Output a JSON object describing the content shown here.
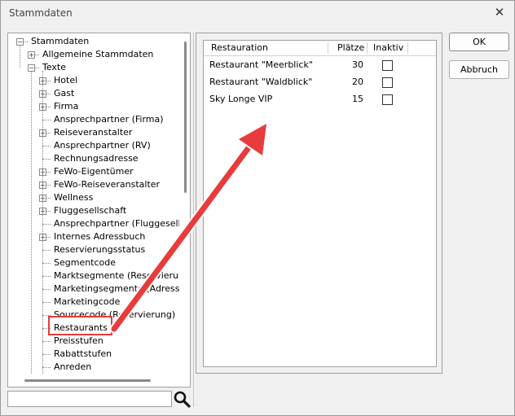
{
  "window": {
    "title": "Stammdaten",
    "close_glyph": "✕"
  },
  "tree": {
    "items": [
      {
        "label": "Stammdaten",
        "expander": "−"
      },
      {
        "label": "Allgemeine Stammdaten",
        "expander": "+"
      },
      {
        "label": "Texte",
        "expander": "−"
      },
      {
        "label": "Hotel",
        "expander": "+"
      },
      {
        "label": "Gast",
        "expander": "+"
      },
      {
        "label": "Firma",
        "expander": "+"
      },
      {
        "label": "Ansprechpartner (Firma)",
        "expander": ""
      },
      {
        "label": "Reiseveranstalter",
        "expander": "+"
      },
      {
        "label": "Ansprechpartner (RV)",
        "expander": ""
      },
      {
        "label": "Rechnungsadresse",
        "expander": ""
      },
      {
        "label": "FeWo-Eigentümer",
        "expander": "+"
      },
      {
        "label": "FeWo-Reiseveranstalter",
        "expander": "+"
      },
      {
        "label": "Wellness",
        "expander": "+"
      },
      {
        "label": "Fluggesellschaft",
        "expander": "+"
      },
      {
        "label": "Ansprechpartner (Fluggesellschaft)",
        "expander": ""
      },
      {
        "label": "Internes Adressbuch",
        "expander": "+"
      },
      {
        "label": "Reservierungsstatus",
        "expander": ""
      },
      {
        "label": "Segmentcode",
        "expander": ""
      },
      {
        "label": "Marktsegmente (Reservierung)",
        "expander": ""
      },
      {
        "label": "Marketingsegmente (Adresse)",
        "expander": ""
      },
      {
        "label": "Marketingcode",
        "expander": ""
      },
      {
        "label": "Sourcecode (Reservierung)",
        "expander": ""
      },
      {
        "label": "Restaurants",
        "expander": ""
      },
      {
        "label": "Preisstufen",
        "expander": ""
      },
      {
        "label": "Rabattstufen",
        "expander": ""
      },
      {
        "label": "Anreden",
        "expander": ""
      }
    ]
  },
  "search": {
    "value": "",
    "placeholder": ""
  },
  "grid": {
    "columns": [
      "Restauration",
      "Plätze",
      "Inaktiv"
    ],
    "rows": [
      {
        "name": "Restaurant \"Meerblick\"",
        "seats": "30",
        "inactive": false
      },
      {
        "name": "Restaurant \"Waldblick\"",
        "seats": "20",
        "inactive": false
      },
      {
        "name": "Sky Longe VIP",
        "seats": "15",
        "inactive": false
      }
    ]
  },
  "buttons": {
    "ok": "OK",
    "cancel": "Abbruch"
  },
  "annotation": {
    "highlight_color": "#e83b3b",
    "highlighted_item": "Restaurants"
  }
}
